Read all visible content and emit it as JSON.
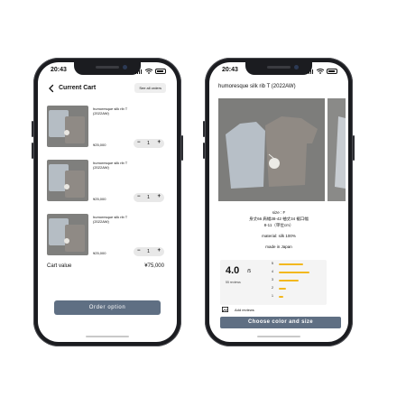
{
  "left_phone": {
    "status": {
      "time": "20:43"
    },
    "header": {
      "title": "Current Cart",
      "see_all_label": "See all orders"
    },
    "items": [
      {
        "name": "humoresque silk rib T (2022AW)",
        "price": "¥25,000",
        "quantity": "1"
      },
      {
        "name": "humoresque silk rib T (2022AW)",
        "price": "¥25,000",
        "quantity": "1"
      },
      {
        "name": "humoresque silk rib T (2022AW)",
        "price": "¥25,000",
        "quantity": "1"
      }
    ],
    "stepper": {
      "minus": "−",
      "plus": "+"
    },
    "cart": {
      "label": "Cart value",
      "total": "¥75,000"
    },
    "order_button": "Order option"
  },
  "right_phone": {
    "status": {
      "time": "20:43"
    },
    "product_title": "humoresque silk rib T (2022AW)",
    "specs": {
      "size": "size : F",
      "measurements_1": "身丈66 肩幅38-42 袖丈34 裾口幅",
      "measurements_2": "8-11（単位cm）",
      "material": "material: silk 100%",
      "origin": "made in Japan"
    },
    "reviews": {
      "rating": "4.0",
      "out_of": "/5",
      "count_label": "55 reviews",
      "bars": [
        {
          "label": "5",
          "fraction": 0.72
        },
        {
          "label": "4",
          "fraction": 0.9
        },
        {
          "label": "3",
          "fraction": 0.58
        },
        {
          "label": "2",
          "fraction": 0.2
        },
        {
          "label": "1",
          "fraction": 0.12
        }
      ],
      "add_label": "Add reviews"
    },
    "choose_button": "Choose color and size"
  },
  "icons": {
    "back": "chevron-left-icon",
    "signal": "signal-icon",
    "wifi": "wifi-icon",
    "battery": "battery-icon",
    "add_review": "image-icon"
  },
  "colors": {
    "primary_button": "#5f6f83",
    "rating_bar": "#f2b81e",
    "stepper_bg": "#e8e8e8",
    "phone_frame": "#1b1c20"
  }
}
